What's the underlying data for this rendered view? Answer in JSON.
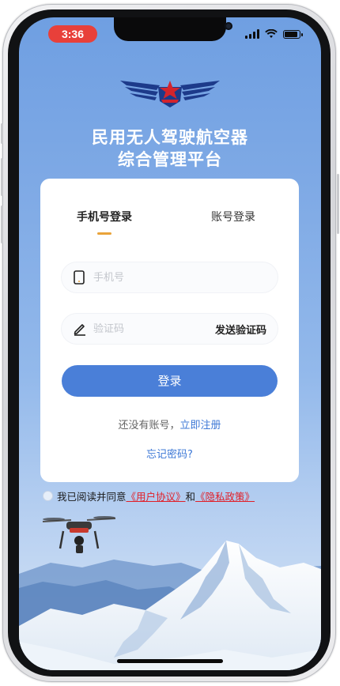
{
  "status_bar": {
    "time": "3:36"
  },
  "app": {
    "title_line1": "民用无人驾驶航空器",
    "title_line2": "综合管理平台"
  },
  "login": {
    "tabs": [
      {
        "label": "手机号登录",
        "active": true
      },
      {
        "label": "账号登录",
        "active": false
      }
    ],
    "phone_placeholder": "手机号",
    "code_placeholder": "验证码",
    "send_code_label": "发送验证码",
    "submit_label": "登录",
    "no_account_text": "还没有账号，",
    "register_link": "立即注册",
    "forgot_password": "忘记密码?"
  },
  "agreement": {
    "prefix": "我已阅读并同意",
    "user_agreement": "《用户协议》",
    "and": "和",
    "privacy_policy": "《隐私政策》"
  },
  "colors": {
    "primary": "#4a7fd8",
    "accent_underline": "#e9a33a",
    "link_red": "#e11f28",
    "time_pill": "#e8403a"
  },
  "icons": [
    "phone-icon",
    "pencil-icon",
    "wifi-icon",
    "signal-icon",
    "battery-icon",
    "logo-wings-icon",
    "drone-icon"
  ]
}
